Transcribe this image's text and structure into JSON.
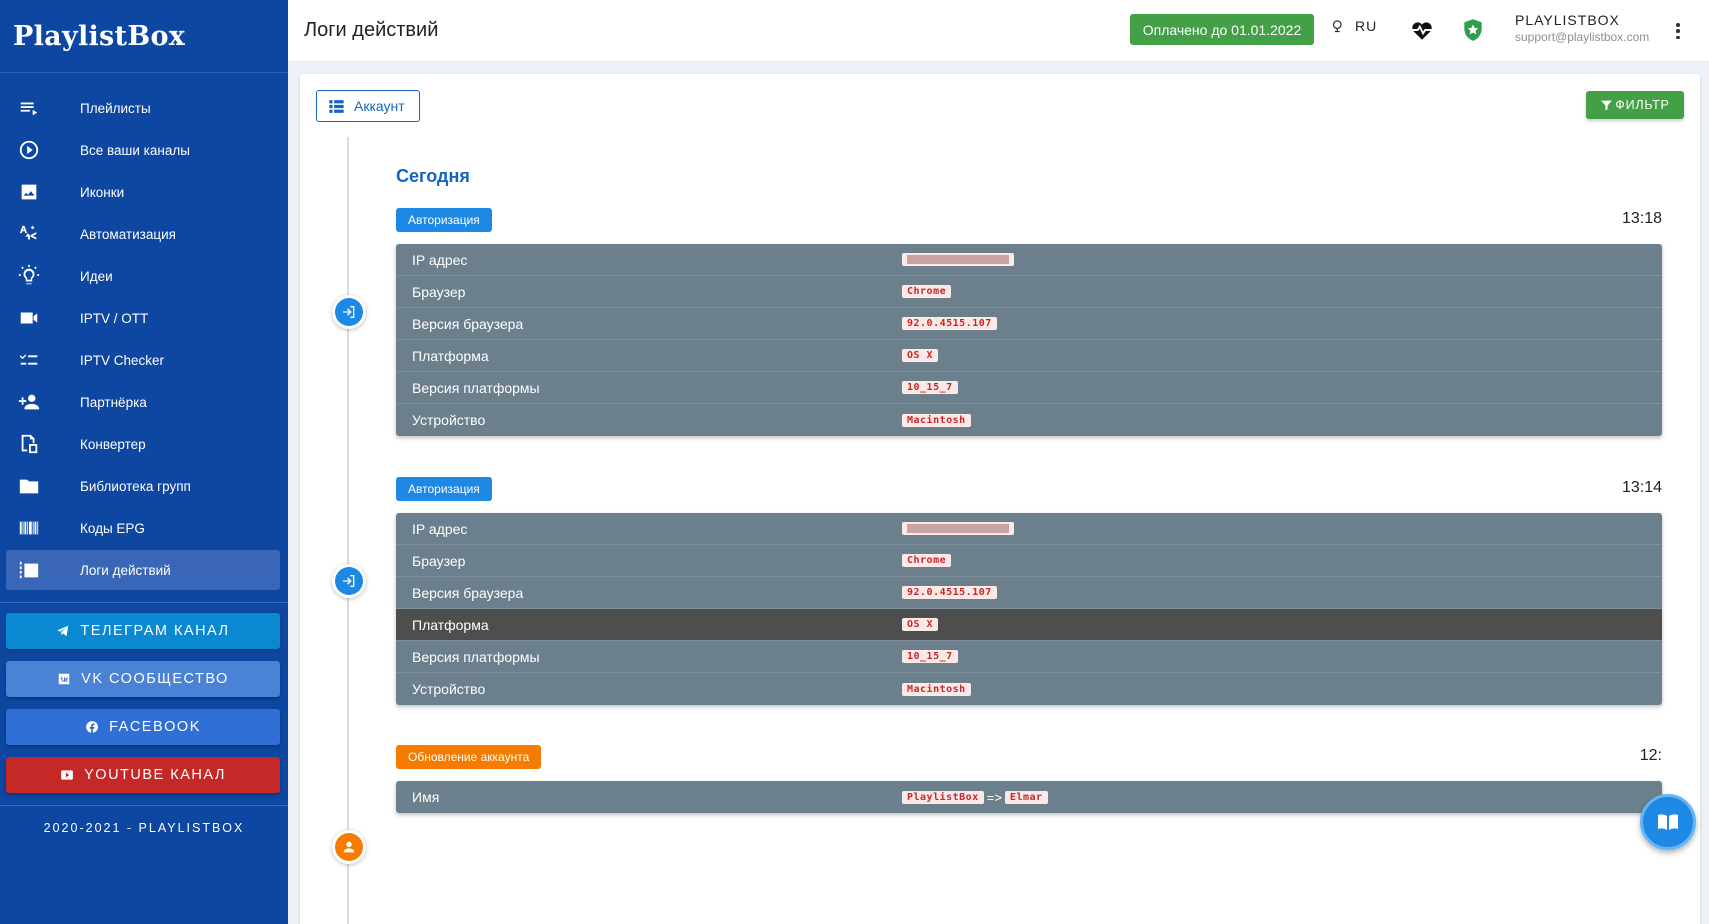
{
  "app": {
    "logo": "PlaylistBox"
  },
  "sidebar": {
    "items": [
      {
        "label": "Плейлисты",
        "icon": "playlist-icon"
      },
      {
        "label": "Все ваши каналы",
        "icon": "play-circle-icon"
      },
      {
        "label": "Иконки",
        "icon": "image-icon"
      },
      {
        "label": "Автоматизация",
        "icon": "automation-icon"
      },
      {
        "label": "Идеи",
        "icon": "lightbulb-icon"
      },
      {
        "label": "IPTV / OTT",
        "icon": "video-camera-icon"
      },
      {
        "label": "IPTV Checker",
        "icon": "checklist-icon"
      },
      {
        "label": "Партнёрка",
        "icon": "person-add-icon"
      },
      {
        "label": "Конвертер",
        "icon": "convert-icon"
      },
      {
        "label": "Библиотека групп",
        "icon": "folder-icon"
      },
      {
        "label": "Коды EPG",
        "icon": "barcode-icon"
      },
      {
        "label": "Логи действий",
        "icon": "checkbox-list-icon",
        "active": true
      }
    ],
    "social": [
      {
        "label": "ТЕЛЕГРАМ КАНАЛ",
        "icon": "telegram-icon",
        "color": "#0a88d1"
      },
      {
        "label": "VK СООБЩЕСТВО",
        "icon": "vk-icon",
        "color": "#4a82d6"
      },
      {
        "label": "FACEBOOK",
        "icon": "facebook-icon",
        "color": "#2f6fd6"
      },
      {
        "label": "YOUTUBE КАНАЛ",
        "icon": "youtube-icon",
        "color": "#c62828"
      }
    ],
    "copyright": "2020-2021 - PLAYLISTBOX"
  },
  "header": {
    "title": "Логи действий",
    "paid_until": "Оплачено до 01.01.2022",
    "lang": "RU",
    "user_name": "PLAYLISTBOX",
    "user_email": "support@playlistbox.com"
  },
  "toolbar": {
    "account_label": "Аккаунт",
    "filter_label": "ФИЛЬТР"
  },
  "timeline": {
    "section": "Сегодня",
    "entries": [
      {
        "type": "Авторизация",
        "time": "13:18",
        "rows": [
          {
            "key": "IP адрес",
            "value": ""
          },
          {
            "key": "Браузер",
            "value": "Chrome"
          },
          {
            "key": "Версия браузера",
            "value": "92.0.4515.107"
          },
          {
            "key": "Платформа",
            "value": "OS X"
          },
          {
            "key": "Версия платформы",
            "value": "10_15_7"
          },
          {
            "key": "Устройство",
            "value": "Macintosh"
          }
        ]
      },
      {
        "type": "Авторизация",
        "time": "13:14",
        "rows": [
          {
            "key": "IP адрес",
            "value": ""
          },
          {
            "key": "Браузер",
            "value": "Chrome"
          },
          {
            "key": "Версия браузера",
            "value": "92.0.4515.107"
          },
          {
            "key": "Платформа",
            "value": "OS X"
          },
          {
            "key": "Версия платформы",
            "value": "10_15_7"
          },
          {
            "key": "Устройство",
            "value": "Macintosh"
          }
        ]
      },
      {
        "type": "Обновление аккаунта",
        "time": "12:",
        "rows": [
          {
            "key": "Имя",
            "old": "PlaylistBox",
            "arrow": "=>",
            "new": "Elmar"
          }
        ]
      }
    ]
  },
  "colors": {
    "primary": "#0d47a1",
    "accent": "#1e88e5",
    "success": "#43a047",
    "warning": "#f57c00"
  }
}
